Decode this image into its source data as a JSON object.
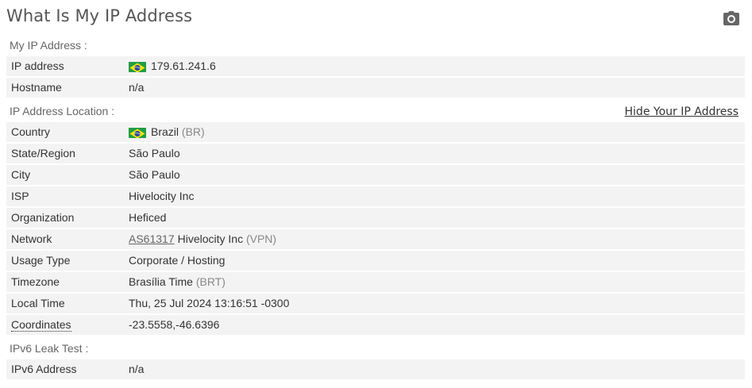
{
  "title": "What Is My IP Address",
  "sections": {
    "my_ip": "My IP Address :",
    "location": "IP Address Location :",
    "ipv6": "IPv6 Leak Test :"
  },
  "hide_link": "Hide Your IP Address",
  "my_ip": {
    "ip_label": "IP address",
    "ip_value": "179.61.241.6",
    "hostname_label": "Hostname",
    "hostname_value": "n/a"
  },
  "location": {
    "country_label": "Country",
    "country_value": "Brazil",
    "country_code": "(BR)",
    "state_label": "State/Region",
    "state_value": "São Paulo",
    "city_label": "City",
    "city_value": "São Paulo",
    "isp_label": "ISP",
    "isp_value": "Hivelocity Inc",
    "org_label": "Organization",
    "org_value": "Heficed",
    "network_label": "Network",
    "network_asn": "AS61317",
    "network_name": "Hivelocity Inc",
    "network_tag": "(VPN)",
    "usage_label": "Usage Type",
    "usage_value": "Corporate / Hosting",
    "tz_label": "Timezone",
    "tz_value": "Brasília Time",
    "tz_code": "(BRT)",
    "localtime_label": "Local Time",
    "localtime_value": "Thu, 25 Jul 2024 13:16:51 -0300",
    "coords_label": "Coordinates",
    "coords_value": "-23.5558,-46.6396"
  },
  "ipv6": {
    "address_label": "IPv6 Address",
    "address_value": "n/a"
  },
  "icons": {
    "camera": "camera-icon",
    "flag": "brazil-flag-icon"
  },
  "colors": {
    "row_bg": "#f3f3f3",
    "muted": "#888888",
    "flag_green": "#229e45",
    "flag_yellow": "#f8e509",
    "flag_blue": "#2b49a3"
  }
}
